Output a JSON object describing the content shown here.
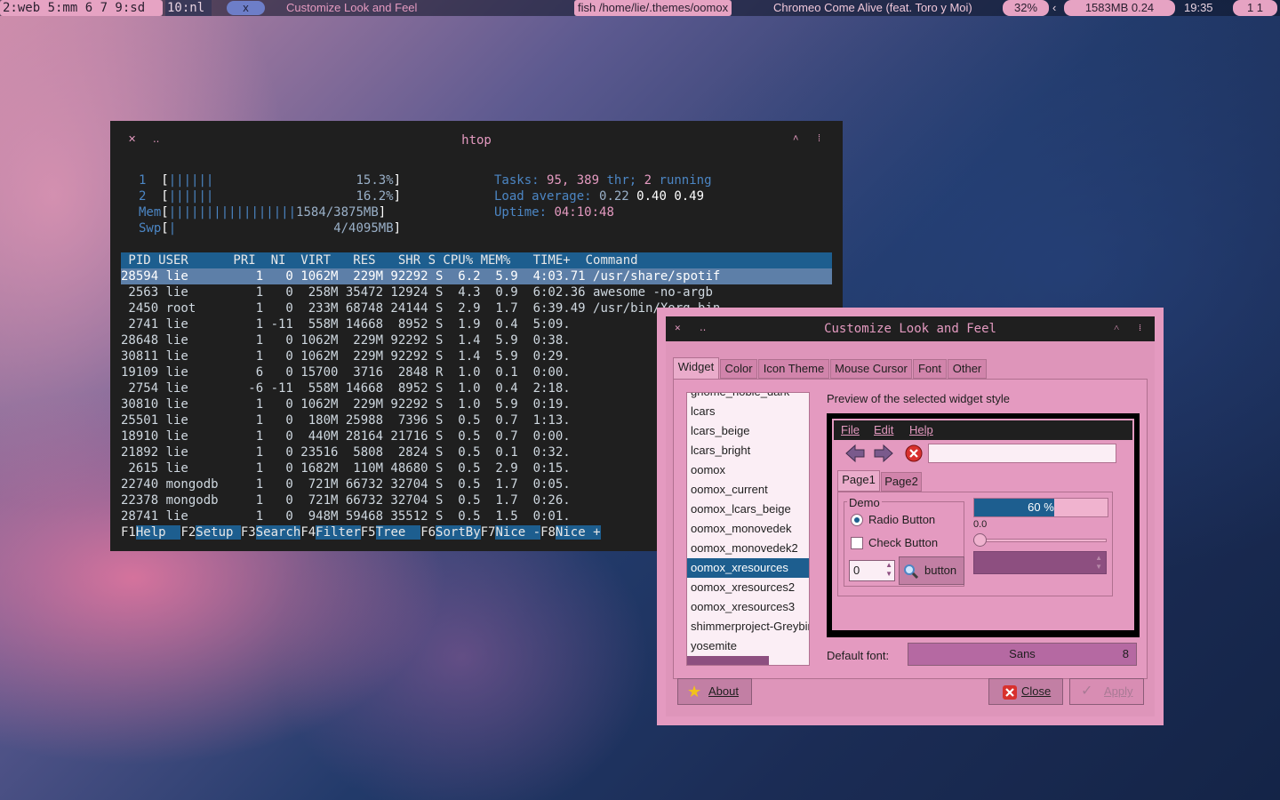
{
  "topbar": {
    "tags": "2:web 5:mm 6 7 9:sd",
    "tag10": "10:nl",
    "layout": "x",
    "window_title": "Customize Look and Feel",
    "path": "fish /home/lie/.themes/oomox",
    "song": "Chromeo Come Alive (feat. Toro y Moi)",
    "volume": "32%",
    "arrow": "‹",
    "mem": "1583MB 0.24",
    "clock": "19:35",
    "kbd": "1 1"
  },
  "htop": {
    "title": "htop",
    "cpu1_label": "1",
    "cpu1_pct": "15.3%",
    "cpu2_label": "2",
    "cpu2_pct": "16.2%",
    "mem_label": "Mem",
    "mem_val": "1584/3875MB",
    "swp_label": "Swp",
    "swp_val": "4/4095MB",
    "tasks_label": "Tasks:",
    "tasks_n": "95,",
    "threads_n": "389",
    "thr": "thr;",
    "running_n": "2",
    "running": "running",
    "load_label": "Load average:",
    "load1": "0.22",
    "load5": "0.40",
    "load15": "0.49",
    "uptime_label": "Uptime:",
    "uptime": "04:10:48",
    "columns": " PID USER      PRI  NI  VIRT   RES   SHR S CPU% MEM%   TIME+  Command",
    "rows": [
      "28594 lie         1   0 1062M  229M 92292 S  6.2  5.9  4:03.71 /usr/share/spotif",
      " 2563 lie         1   0  258M 35472 12924 S  4.3  0.9  6:02.36 awesome -no-argb",
      " 2450 root        1   0  233M 68748 24144 S  2.9  1.7  6:39.49 /usr/bin/Xorg bin",
      " 2741 lie         1 -11  558M 14668  8952 S  1.9  0.4  5:09.",
      "28648 lie         1   0 1062M  229M 92292 S  1.4  5.9  0:38.",
      "30811 lie         1   0 1062M  229M 92292 S  1.4  5.9  0:29.",
      "19109 lie         6   0 15700  3716  2848 R  1.0  0.1  0:00.",
      " 2754 lie        -6 -11  558M 14668  8952 S  1.0  0.4  2:18.",
      "30810 lie         1   0 1062M  229M 92292 S  1.0  5.9  0:19.",
      "25501 lie         1   0  180M 25988  7396 S  0.5  0.7  1:13.",
      "18910 lie         1   0  440M 28164 21716 S  0.5  0.7  0:00.",
      "21892 lie         1   0 23516  5808  2824 S  0.5  0.1  0:32.",
      " 2615 lie         1   0 1682M  110M 48680 S  0.5  2.9  0:15.",
      "22740 mongodb     1   0  721M 66732 32704 S  0.5  1.7  0:05.",
      "22378 mongodb     1   0  721M 66732 32704 S  0.5  1.7  0:26.",
      "28741 lie         1   0  948M 59468 35512 S  0.5  1.5  0:01."
    ],
    "fkeys": [
      [
        "F1",
        "Help  "
      ],
      [
        "F2",
        "Setup "
      ],
      [
        "F3",
        "Search"
      ],
      [
        "F4",
        "Filter"
      ],
      [
        "F5",
        "Tree  "
      ],
      [
        "F6",
        "SortBy"
      ],
      [
        "F7",
        "Nice -"
      ],
      [
        "F8",
        "Nice +"
      ]
    ]
  },
  "dialog": {
    "title": "Customize Look and Feel",
    "tabs": [
      "Widget",
      "Color",
      "Icon Theme",
      "Mouse Cursor",
      "Font",
      "Other"
    ],
    "themes": [
      "gnome_noble_dark",
      "lcars",
      "lcars_beige",
      "lcars_bright",
      "oomox",
      "oomox_current",
      "oomox_lcars_beige",
      "oomox_monovedek",
      "oomox_monovedek2",
      "oomox_xresources",
      "oomox_xresources2",
      "oomox_xresources3",
      "shimmerproject-Greybird",
      "yosemite"
    ],
    "selected_theme": "oomox_xresources",
    "preview_label": "Preview of the selected widget style",
    "menu": [
      "File",
      "Edit",
      "Help"
    ],
    "inner_tabs": [
      "Page1",
      "Page2"
    ],
    "demo_label": "Demo",
    "radio_label": "Radio Button",
    "check_label": "Check Button",
    "spin_value": "0",
    "button_label": "button",
    "progress_text": "60 %",
    "progress_value": 0.6,
    "slider_value": "0.0",
    "default_font_label": "Default font:",
    "font_name": "Sans",
    "font_size": "8",
    "about_label": "About",
    "close_label": "Close",
    "apply_label": "Apply"
  }
}
